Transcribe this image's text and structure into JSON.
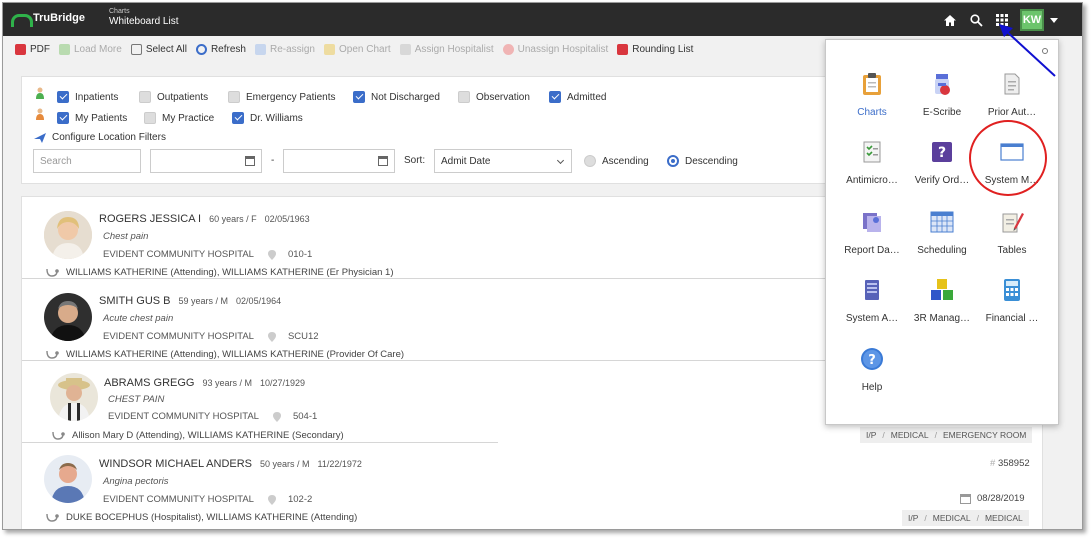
{
  "header": {
    "brand": "TruBridge",
    "section": "Charts",
    "title": "Whiteboard List",
    "user_initials": "KW"
  },
  "toolbar": {
    "pdf": "PDF",
    "load_more": "Load More",
    "select_all": "Select All",
    "refresh": "Refresh",
    "reassign": "Re-assign",
    "open_chart": "Open Chart",
    "assign_hospitalist": "Assign Hospitalist",
    "unassign_hospitalist": "Unassign Hospitalist",
    "rounding_list": "Rounding List"
  },
  "filters": {
    "inpatients": "Inpatients",
    "outpatients": "Outpatients",
    "emergency": "Emergency Patients",
    "not_discharged": "Not Discharged",
    "observation": "Observation",
    "admitted": "Admitted",
    "my_patients": "My Patients",
    "my_practice": "My Practice",
    "dr_williams": "Dr. Williams",
    "configure_location": "Configure Location Filters",
    "search_placeholder": "Search",
    "range_sep": "-",
    "sort_label": "Sort:",
    "sort_value": "Admit Date",
    "ascending": "Ascending",
    "descending": "Descending"
  },
  "patients": [
    {
      "name": "ROGERS JESSICA I",
      "age_sex": "60 years / F",
      "dob": "02/05/1963",
      "diagnosis": "Chest pain",
      "facility": "EVIDENT COMMUNITY HOSPITAL",
      "room": "010-1",
      "providers": "WILLIAMS KATHERINE (Attending), WILLIAMS KATHERINE (Er Physician 1)"
    },
    {
      "name": "SMITH GUS B",
      "age_sex": "59 years / M",
      "dob": "02/05/1964",
      "diagnosis": "Acute chest pain",
      "facility": "EVIDENT COMMUNITY HOSPITAL",
      "room": "SCU12",
      "providers": "WILLIAMS KATHERINE (Attending), WILLIAMS KATHERINE (Provider Of Care)"
    },
    {
      "name": "ABRAMS GREGG",
      "age_sex": "93 years / M",
      "dob": "10/27/1929",
      "diagnosis": "CHEST PAIN",
      "facility": "EVIDENT COMMUNITY HOSPITAL",
      "room": "504-1",
      "providers": "Allison Mary D (Attending), WILLIAMS KATHERINE (Secondary)",
      "tags": [
        "I/P",
        "MEDICAL",
        "EMERGENCY ROOM"
      ]
    },
    {
      "name": "WINDSOR MICHAEL ANDERS",
      "age_sex": "50 years / M",
      "dob": "11/22/1972",
      "diagnosis": "Angina pectoris",
      "facility": "EVIDENT COMMUNITY HOSPITAL",
      "room": "102-2",
      "providers": "DUKE BOCEPHUS (Hospitalist), WILLIAMS KATHERINE (Attending)",
      "account": "358952",
      "admit_date": "08/28/2019",
      "tags": [
        "I/P",
        "MEDICAL",
        "MEDICAL"
      ]
    }
  ],
  "launcher": {
    "apps": [
      {
        "label": "Charts",
        "icon": "clipboard-icon"
      },
      {
        "label": "E-Scribe",
        "icon": "pill-bottle-icon"
      },
      {
        "label": "Prior Aut…",
        "icon": "document-icon"
      },
      {
        "label": "Antimicro…",
        "icon": "checklist-icon"
      },
      {
        "label": "Verify Ord…",
        "icon": "question-box-icon"
      },
      {
        "label": "System M…",
        "icon": "window-icon"
      },
      {
        "label": "Report Da…",
        "icon": "report-icon"
      },
      {
        "label": "Scheduling",
        "icon": "calendar-grid-icon"
      },
      {
        "label": "Tables",
        "icon": "notepad-pencil-icon"
      },
      {
        "label": "System A…",
        "icon": "server-icon"
      },
      {
        "label": "3R Manag…",
        "icon": "blocks-icon"
      },
      {
        "label": "Financial …",
        "icon": "calculator-icon"
      },
      {
        "label": "Help",
        "icon": "help-circle-icon"
      }
    ]
  },
  "colors": {
    "topbar": "#2b2b2b",
    "accent": "#3b6dc9",
    "brand_green": "#2fb24a",
    "highlight_circle": "#e02020",
    "arrow": "#1010d0"
  }
}
